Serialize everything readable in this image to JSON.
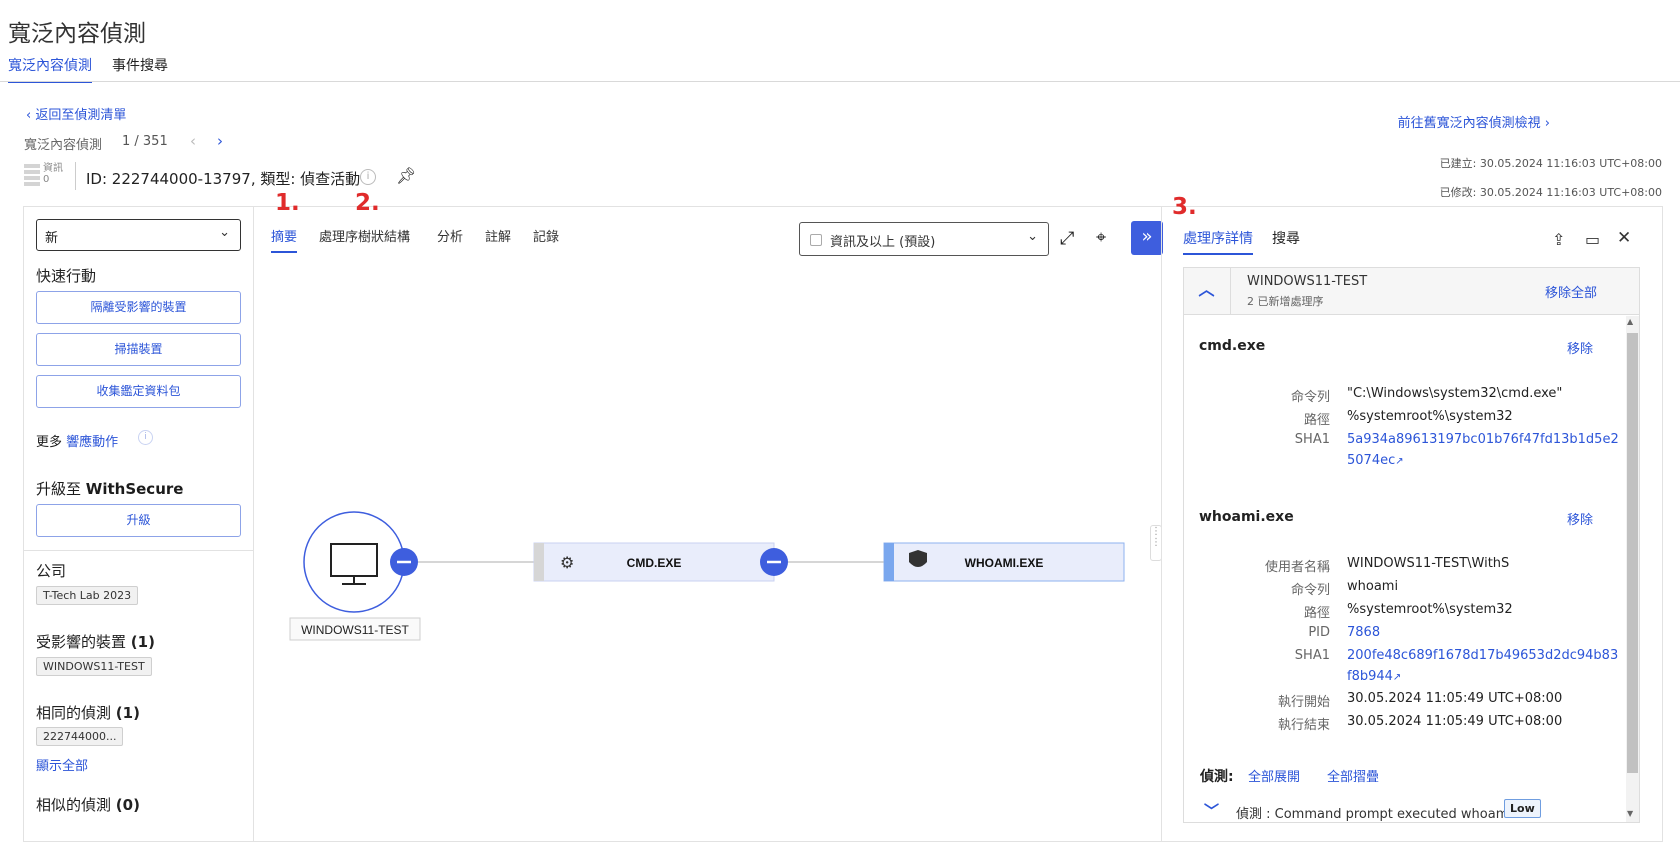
{
  "header": {
    "title": "寬泛內容偵測",
    "tabs": [
      {
        "label": "寬泛內容偵測"
      },
      {
        "label": "事件搜尋"
      }
    ]
  },
  "nav": {
    "back_label": "返回至偵測清單",
    "pager_label": "寬泛內容偵測",
    "pager_count": "1 / 351",
    "goto_label": "前往舊寬泛內容偵測檢視"
  },
  "detection": {
    "severity_label": "資訊",
    "severity_count": "0",
    "id_text": "ID: 222744000-13797, 類型: 偵查活動",
    "created": "已建立: 30.05.2024 11:16:03 UTC+08:00",
    "modified": "已修改: 30.05.2024 11:16:03 UTC+08:00"
  },
  "left_panel": {
    "status_value": "新",
    "quick_actions_title": "快速行動",
    "quick_actions": [
      "隔離受影響的裝置",
      "掃描裝置",
      "收集鑑定資料包"
    ],
    "more_prefix": "更多",
    "more_link": "響應動作",
    "upgrade_prefix": "升級至",
    "upgrade_brand": "WithSecure",
    "upgrade_button": "升級",
    "company_title": "公司",
    "company_value": "T-Tech Lab 2023",
    "affected_title": "受影響的裝置",
    "affected_count": "(1)",
    "affected_value": "WINDOWS11-TEST",
    "same_title": "相同的偵測",
    "same_count": "(1)",
    "same_value": "222744000...",
    "show_all": "顯示全部",
    "similar_title": "相似的偵測",
    "similar_count": "(0)"
  },
  "center": {
    "tabs": [
      "摘要",
      "處理序樹狀結構",
      "分析",
      "註解",
      "記錄"
    ],
    "annotations": [
      "1.",
      "2.",
      "3."
    ],
    "level_select": "資訊及以上 (預設)",
    "graph": {
      "host_label": "WINDOWS11-TEST",
      "process_1": "CMD.EXE",
      "process_2": "WHOAMI.EXE"
    }
  },
  "right_panel": {
    "tabs": [
      "處理序詳情",
      "搜尋"
    ],
    "host_name": "WINDOWS11-TEST",
    "host_sub": "2 已新增處理序",
    "remove_all": "移除全部",
    "remove_label": "移除",
    "cmd": {
      "name": "cmd.exe",
      "rows": [
        {
          "key": "命令列",
          "value": "\"C:\\Windows\\system32\\cmd.exe\""
        },
        {
          "key": "路徑",
          "value": "%systemroot%\\system32"
        },
        {
          "key": "SHA1",
          "value": "5a934a89613197bc01b76f47fd13b1d5e2",
          "value2": "5074ec"
        }
      ]
    },
    "whoami": {
      "name": "whoami.exe",
      "rows": [
        {
          "key": "使用者名稱",
          "value": "WINDOWS11-TEST\\WithS"
        },
        {
          "key": "命令列",
          "value": "whoami"
        },
        {
          "key": "路徑",
          "value": "%systemroot%\\system32"
        },
        {
          "key": "PID",
          "value": "7868"
        },
        {
          "key": "SHA1",
          "value": "200fe48c689f1678d17b49653d2dc94b83",
          "value2": "f8b944"
        },
        {
          "key": "執行開始",
          "value": "30.05.2024 11:05:49 UTC+08:00"
        },
        {
          "key": "執行結束",
          "value": "30.05.2024 11:05:49 UTC+08:00"
        }
      ]
    },
    "detections_label": "偵測:",
    "expand_all": "全部展開",
    "collapse_all": "全部摺疊",
    "detection_row": "偵測 : Command prompt executed whoami",
    "detection_badge": "Low"
  },
  "colors": {
    "accent": "#2c55d8",
    "annotation": "#e02b2b",
    "button_fill": "#3e5ede"
  }
}
